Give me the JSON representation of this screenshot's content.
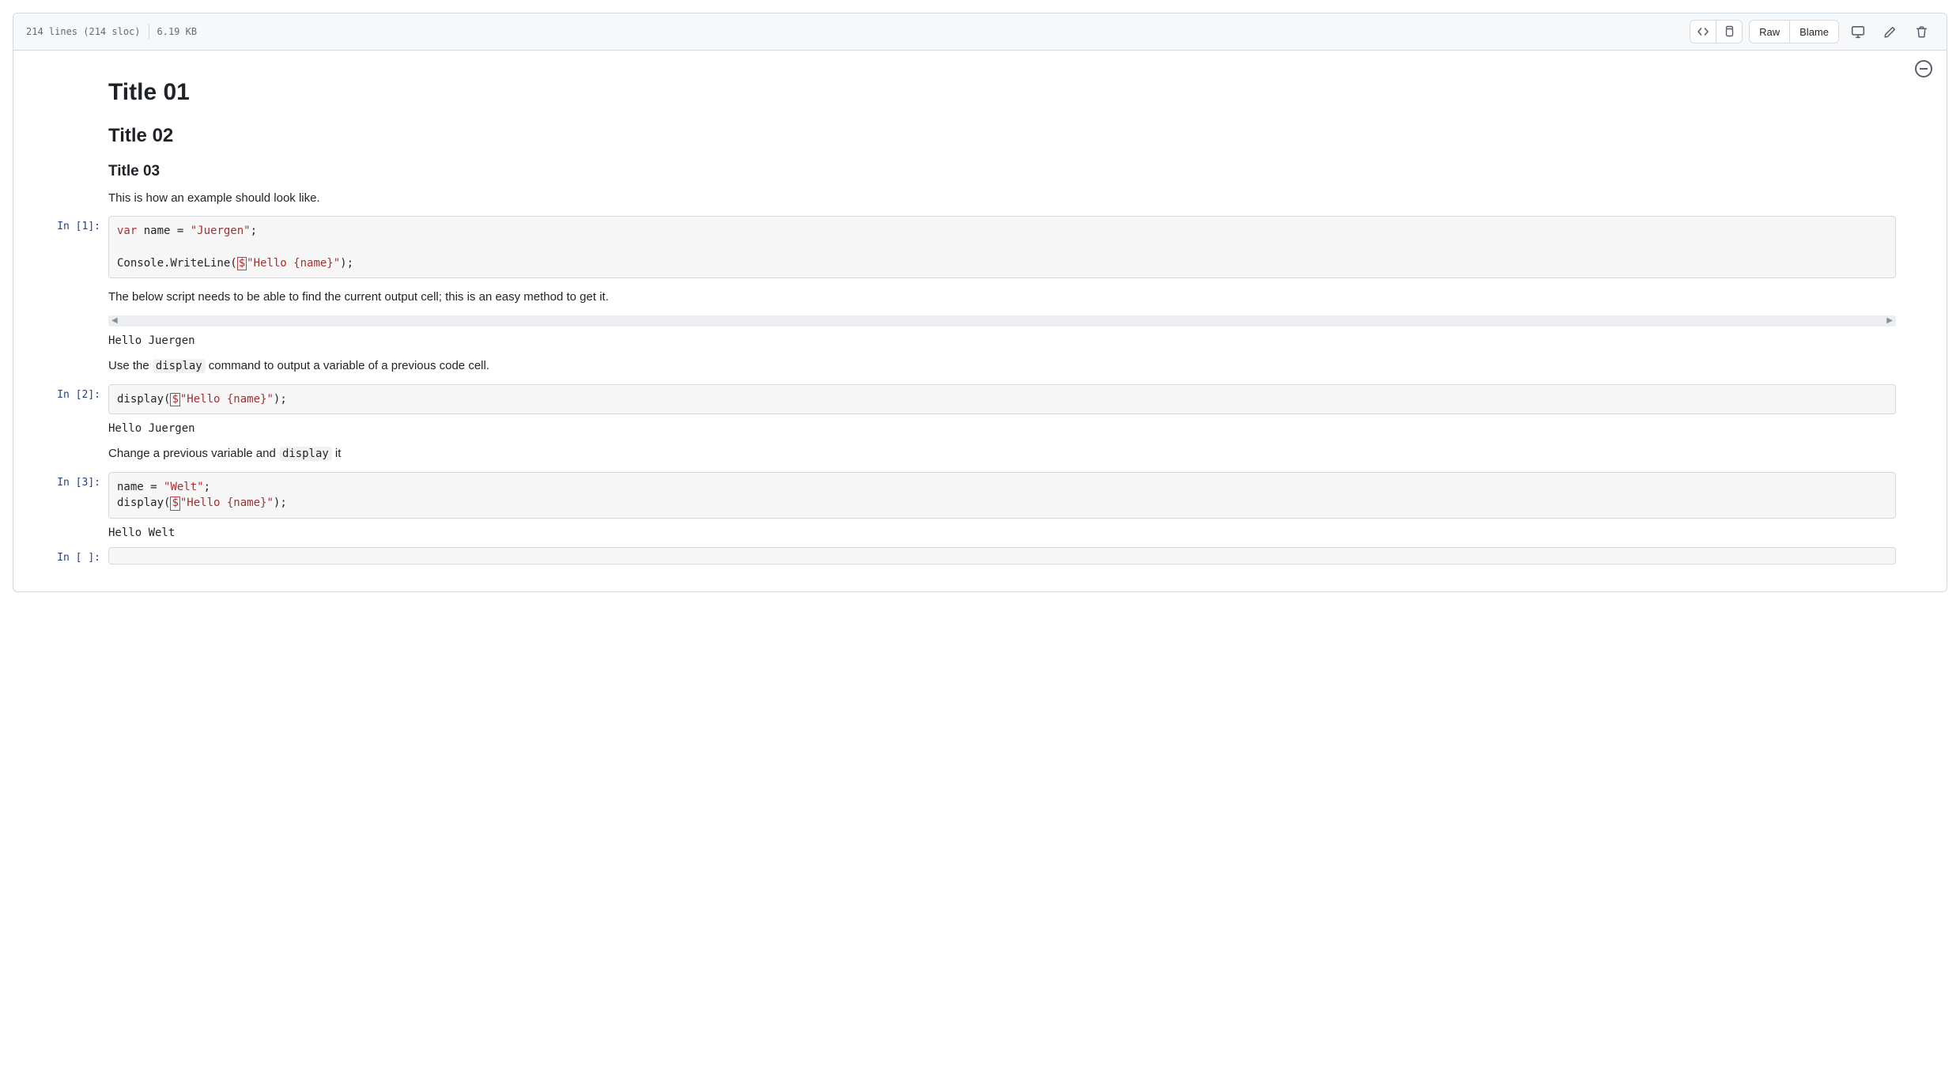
{
  "toolbar": {
    "lines": "214 lines (214 sloc)",
    "size": "6.19 KB",
    "raw": "Raw",
    "blame": "Blame"
  },
  "icons": {
    "code": "code-brackets-icon",
    "copy": "copy-icon",
    "monitor": "desktop-download-icon",
    "edit": "pencil-icon",
    "delete": "trash-icon",
    "collapse": "collapse-icon"
  },
  "notebook": {
    "h1": "Title 01",
    "h2": "Title 02",
    "h3": "Title 03",
    "intro": "This is how an example should look like.",
    "cell1": {
      "prompt": "In [1]:",
      "line1_kw": "var",
      "line1_mid": " name = ",
      "line1_str": "\"Juergen\"",
      "line1_end": ";",
      "line2_pre": "Console.WriteLine(",
      "line2_dollar": "$",
      "line2_str": "\"Hello {name}\"",
      "line2_end": ");"
    },
    "after1_md": "The below script needs to be able to find the current output cell; this is an easy method to get it.",
    "out1": "Hello Juergen",
    "md_display_pre": "Use the ",
    "md_display_code": "display",
    "md_display_post": " command to output a variable of a previous code cell.",
    "cell2": {
      "prompt": "In [2]:",
      "pre": "display(",
      "dollar": "$",
      "str": "\"Hello {name}\"",
      "end": ");"
    },
    "out2": "Hello Juergen",
    "md_change_pre": "Change a previous variable and ",
    "md_change_code": "display",
    "md_change_post": " it",
    "cell3": {
      "prompt": "In [3]:",
      "l1_pre": "name = ",
      "l1_str": "\"Welt\"",
      "l1_end": ";",
      "l2_pre": "display(",
      "l2_dollar": "$",
      "l2_str": "\"Hello {name}\"",
      "l2_end": ");"
    },
    "out3": "Hello Welt",
    "cell_empty_prompt": "In [ ]:"
  }
}
